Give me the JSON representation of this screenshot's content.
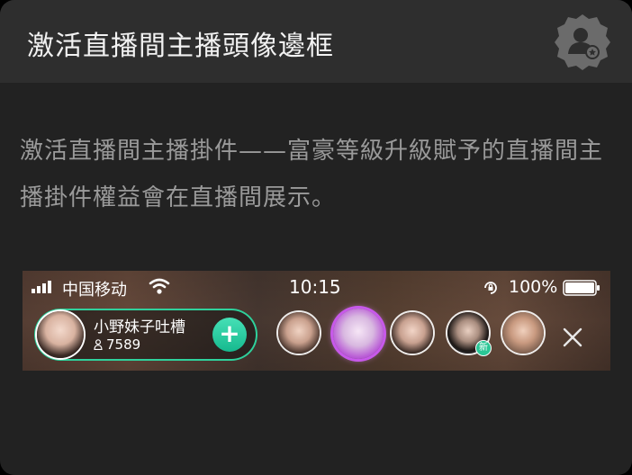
{
  "header": {
    "title": "激活直播間主播頭像邊框",
    "icon": "avatar-badge-icon"
  },
  "description": "激活直播間主播掛件——富豪等級升級賦予的直播間主播掛件權益會在直播間展示。",
  "preview": {
    "status_bar": {
      "carrier": "中国移动",
      "time": "10:15",
      "battery": "100%"
    },
    "anchor": {
      "name": "小野妹子吐槽",
      "fans": "7589",
      "follow_label": "+"
    },
    "viewers": [
      {
        "name": "viewer-1"
      },
      {
        "name": "viewer-2-framed"
      },
      {
        "name": "viewer-3"
      },
      {
        "name": "viewer-4"
      },
      {
        "name": "viewer-5"
      }
    ],
    "new_badge": "新"
  },
  "colors": {
    "card_bg": "#222222",
    "header_bg": "#2e2e2e",
    "accent": "#2fd19c",
    "frame_purple": "#c759ea"
  }
}
